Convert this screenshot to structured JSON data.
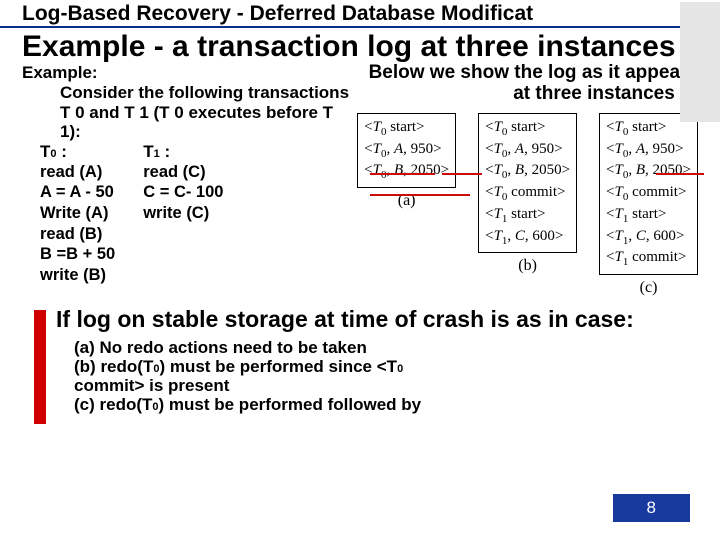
{
  "topic": "Log-Based Recovery - Deferred Database Modificat",
  "title": "Example - a transaction log at three instances",
  "example_label": "Example:",
  "consider": "Consider the following transactions  T 0 and T 1 (T 0 executes before T 1):",
  "t0": {
    "head": "T",
    "headsub": "0",
    "headcolon": " :",
    "ops": [
      "read (A)",
      "A = A - 50",
      "Write (A)",
      "read (B)",
      "B =B + 50",
      "write (B)"
    ]
  },
  "t1": {
    "head": "T",
    "headsub": "1",
    "headcolon": " :",
    "ops": [
      "read (C)",
      "C = C- 100",
      "write (C)"
    ]
  },
  "right_intro": "Below we show the log as it appears at three instances of",
  "logs": {
    "a": [
      "<T0 start>",
      "<T0, A, 950>",
      "<T0, B, 2050>"
    ],
    "b": [
      "<T0 start>",
      "<T0, A, 950>",
      "<T0, B, 2050>",
      "<T0 commit>",
      "<T1 start>",
      "<T1, C, 600>"
    ],
    "c": [
      "<T0 start>",
      "<T0, A, 950>",
      "<T0, B, 2050>",
      "<T0 commit>",
      "<T1 start>",
      "<T1, C, 600>",
      "<T1 commit>"
    ],
    "cap_a": "(a)",
    "cap_b": "(b)",
    "cap_c": "(c)"
  },
  "crash_lead": "If log on stable storage at time of crash is as in case:",
  "case_a_pre": "(a) ",
  "case_a_em": "No",
  "case_a_post": " redo actions need to be taken",
  "case_b_pre": "(b) ",
  "case_b_em": "redo(T",
  "case_b_sub": "0",
  "case_b_em2": ")",
  "case_b_post_1": " must be performed since ",
  "case_b_tag_open": "<T",
  "case_b_tag_sub": "0",
  "case_b_tag_2": " commit>",
  "case_b_post_2": " is present",
  "case_c_pre": "(c) ",
  "case_c_em": "redo(T",
  "case_c_sub": "0",
  "case_c_em2": ")",
  "case_c_post": " must be performed followed by",
  "slide_number": "8"
}
